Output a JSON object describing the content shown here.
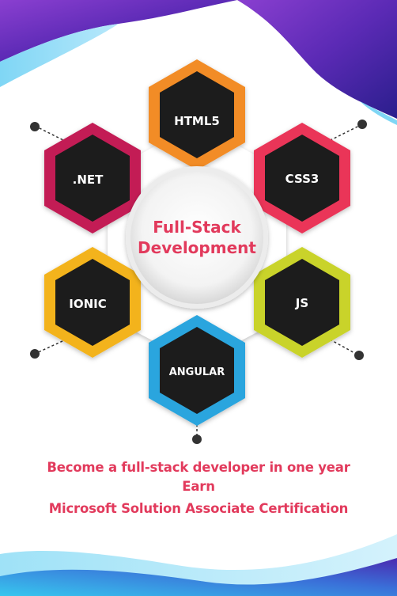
{
  "center": {
    "line1": "Full-Stack",
    "line2": "Development"
  },
  "nodes": [
    {
      "label": "HTML5",
      "color": "#f28c28"
    },
    {
      "label": "CSS3",
      "color": "#ea3659"
    },
    {
      "label": "JS",
      "color": "#c9d32a"
    },
    {
      "label": "ANGULAR",
      "color": "#2aa5de"
    },
    {
      "label": "IONIC",
      "color": "#f3b31b"
    },
    {
      "label": ".NET",
      "color": "#c31f55"
    }
  ],
  "tagline": {
    "line1": "Become a full-stack developer in one year",
    "line2": "Earn",
    "line3": "Microsoft Solution Associate Certification"
  },
  "colors": {
    "accent": "#e23a5c",
    "hex_dark": "#1a1a1a",
    "wave_purple": "#5b2ab5",
    "wave_blue": "#3fa0e8"
  }
}
